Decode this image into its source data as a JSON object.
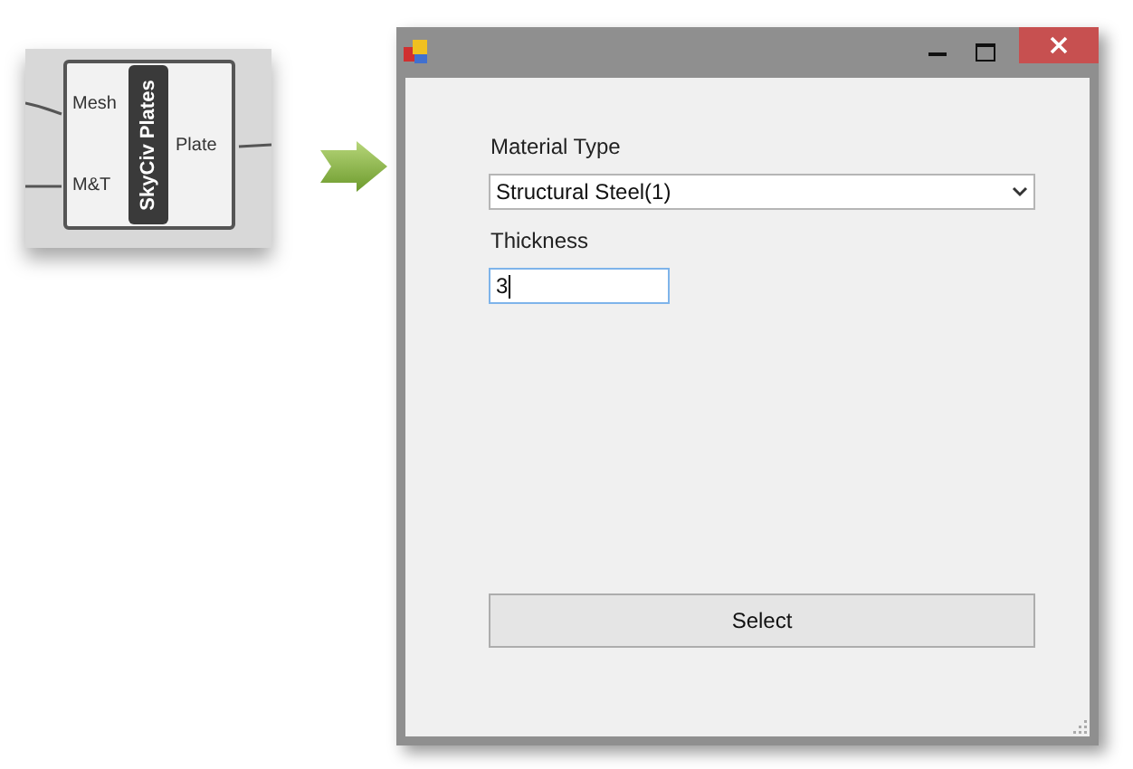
{
  "component": {
    "title": "SkyCiv Plates",
    "inputs": [
      "Mesh",
      "M&T"
    ],
    "outputs": [
      "Plate"
    ]
  },
  "dialog": {
    "fields": [
      {
        "kind": "dropdown",
        "label": "Material Type",
        "value": "Structural Steel(1)",
        "focused": false
      },
      {
        "kind": "text",
        "label": "Thickness",
        "value": "3",
        "focused": true
      }
    ],
    "button": "Select"
  }
}
